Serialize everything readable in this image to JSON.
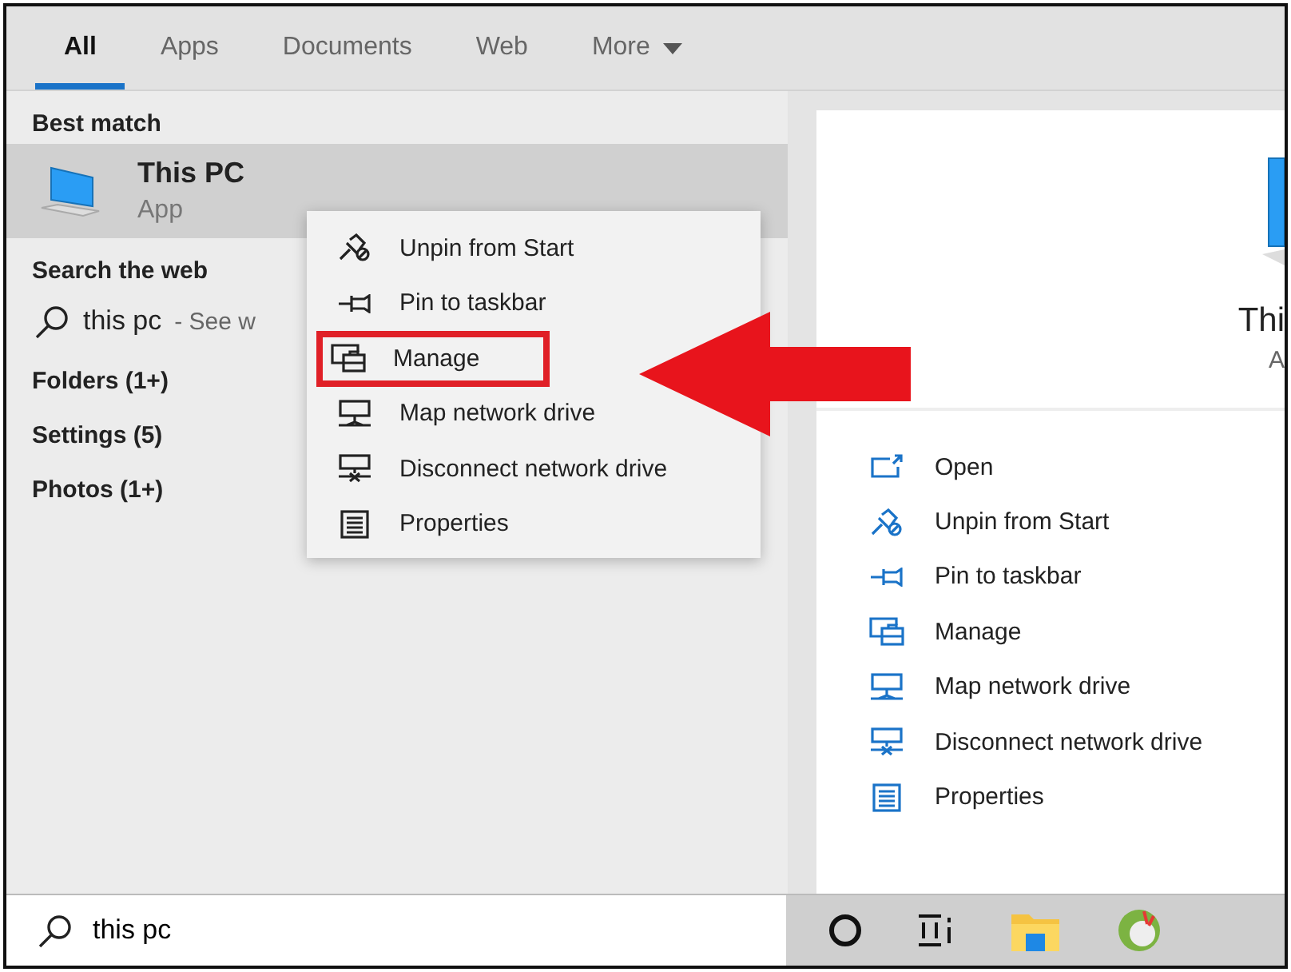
{
  "tabs": [
    {
      "label": "All",
      "selected": true
    },
    {
      "label": "Apps",
      "selected": false
    },
    {
      "label": "Documents",
      "selected": false
    },
    {
      "label": "Web",
      "selected": false
    },
    {
      "label": "More",
      "selected": false,
      "dropdown": true
    }
  ],
  "best_match": {
    "heading": "Best match",
    "title": "This PC",
    "subtitle": "App",
    "selected": true
  },
  "web": {
    "heading": "Search the web",
    "query": "this pc",
    "hint": "- See w"
  },
  "categories": [
    "Folders (1+)",
    "Settings (5)",
    "Photos (1+)"
  ],
  "context_menu": [
    {
      "kind": "unpin",
      "label": "Unpin from Start",
      "highlighted": false
    },
    {
      "kind": "pin",
      "label": "Pin to taskbar",
      "highlighted": false
    },
    {
      "kind": "manage",
      "label": "Manage",
      "highlighted": true
    },
    {
      "kind": "map",
      "label": "Map network drive",
      "highlighted": false
    },
    {
      "kind": "disconnect",
      "label": "Disconnect network drive",
      "highlighted": false
    },
    {
      "kind": "properties",
      "label": "Properties",
      "highlighted": false
    }
  ],
  "preview": {
    "title": "Thi",
    "subtitle": "A",
    "actions": [
      {
        "kind": "open",
        "label": "Open"
      },
      {
        "kind": "unpin",
        "label": "Unpin from Start"
      },
      {
        "kind": "pin",
        "label": "Pin to taskbar"
      },
      {
        "kind": "manage",
        "label": "Manage"
      },
      {
        "kind": "map",
        "label": "Map network drive"
      },
      {
        "kind": "disconnect",
        "label": "Disconnect network drive"
      },
      {
        "kind": "properties",
        "label": "Properties"
      }
    ]
  },
  "search_box": {
    "value": "this pc"
  }
}
